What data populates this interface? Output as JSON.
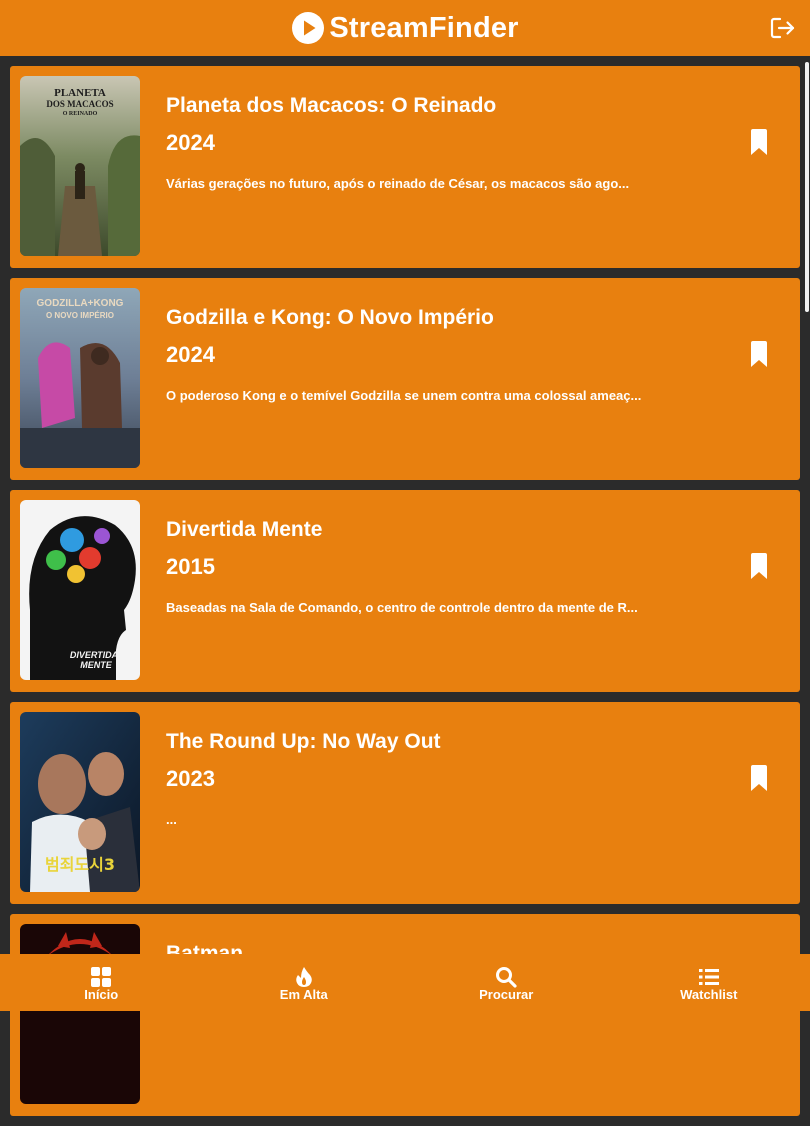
{
  "app": {
    "title": "StreamFinder",
    "accent_color": "#e8800f",
    "background_color": "#2b2b2b",
    "logo_icon": "play-circle-icon",
    "logout_icon": "logout-icon"
  },
  "movies": [
    {
      "title": "Planeta dos Macacos: O Reinado",
      "year": "2024",
      "overview": "Várias gerações no futuro, após o reinado de César, os macacos são ago...",
      "poster_text": [
        "PLANETA",
        "DOS MACACOS",
        "O REINADO"
      ]
    },
    {
      "title": "Godzilla e Kong: O Novo Império",
      "year": "2024",
      "overview": "O poderoso Kong e o temível Godzilla se unem contra uma colossal ameaç...",
      "poster_text": [
        "GODZILLA+KONG",
        "O NOVO IMPÉRIO"
      ]
    },
    {
      "title": "Divertida Mente",
      "year": "2015",
      "overview": "Baseadas na Sala de Comando, o centro de controle dentro da mente de R...",
      "poster_text": [
        "DIVERTIDA",
        "MENTE"
      ]
    },
    {
      "title": "The Round Up: No Way Out",
      "year": "2023",
      "overview": "...",
      "poster_text": [
        "범죄도시3"
      ]
    },
    {
      "title": "Batman",
      "year": "",
      "overview": "",
      "poster_text": []
    }
  ],
  "nav": [
    {
      "label": "Início",
      "icon": "grid-icon"
    },
    {
      "label": "Em Alta",
      "icon": "flame-icon"
    },
    {
      "label": "Procurar",
      "icon": "search-icon"
    },
    {
      "label": "Watchlist",
      "icon": "list-icon"
    }
  ]
}
